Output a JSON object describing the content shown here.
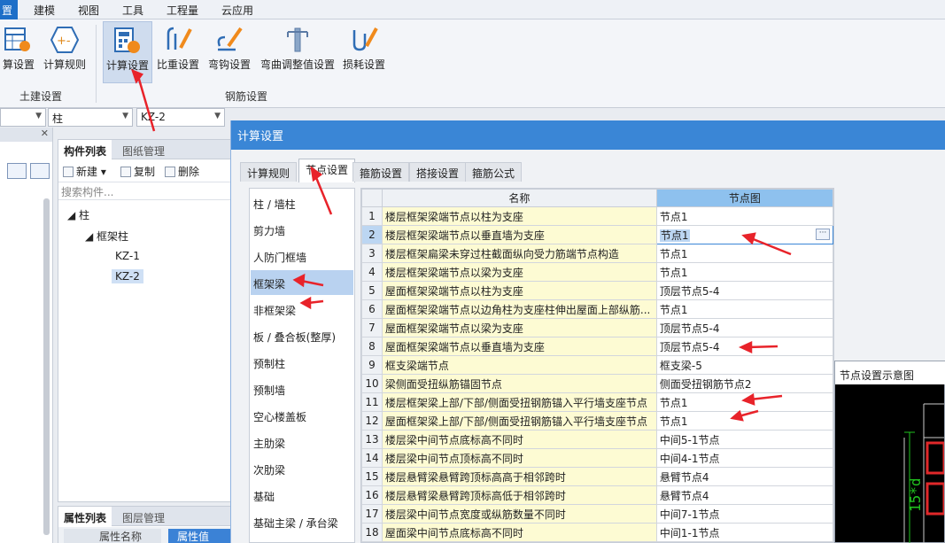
{
  "menu": [
    "置",
    "建模",
    "视图",
    "工具",
    "工程量",
    "云应用"
  ],
  "ribbon": {
    "buttons": [
      {
        "label": "算设置",
        "icon": "table-settings-icon"
      },
      {
        "label": "计算规则",
        "icon": "formula-plus-minus-icon"
      },
      {
        "label": "计算设置",
        "icon": "calculation-settings-icon",
        "selected": true
      },
      {
        "label": "比重设置",
        "icon": "rebar-weight-icon"
      },
      {
        "label": "弯钩设置",
        "icon": "hook-icon"
      },
      {
        "label": "弯曲调整值设置",
        "icon": "bend-adjust-icon"
      },
      {
        "label": "损耗设置",
        "icon": "loss-icon"
      }
    ],
    "groups": [
      "土建设置",
      "钢筋设置"
    ]
  },
  "combos": [
    "",
    "柱",
    "KZ-2"
  ],
  "component_panel": {
    "tabs": [
      "构件列表",
      "图纸管理"
    ],
    "toolbar": [
      "新建",
      "复制",
      "删除"
    ],
    "search_placeholder": "搜索构件...",
    "tree": [
      "柱",
      "框架柱",
      "KZ-1",
      "KZ-2"
    ]
  },
  "property_panel": {
    "tabs": [
      "属性列表",
      "图层管理"
    ],
    "col1": "属性名称",
    "col2": "属性值"
  },
  "dialog": {
    "title": "计算设置",
    "tabs": [
      "计算规则",
      "节点设置",
      "箍筋设置",
      "搭接设置",
      "箍筋公式"
    ],
    "categories": [
      "柱 / 墙柱",
      "剪力墙",
      "人防门框墙",
      "框架梁",
      "非框架梁",
      "板 / 叠合板(整厚)",
      "预制柱",
      "预制墙",
      "空心楼盖板",
      "主肋梁",
      "次肋梁",
      "基础",
      "基础主梁 / 承台梁"
    ],
    "columns": [
      "名称",
      "节点图"
    ],
    "rows": [
      {
        "n": "1",
        "name": "楼层框架梁端节点以柱为支座",
        "node": "节点1"
      },
      {
        "n": "2",
        "name": "楼层框架梁端节点以垂直墙为支座",
        "node": "节点1"
      },
      {
        "n": "3",
        "name": "楼层框架扁梁未穿过柱截面纵向受力筋端节点构造",
        "node": "节点1"
      },
      {
        "n": "4",
        "name": "楼层框架梁端节点以梁为支座",
        "node": "节点1"
      },
      {
        "n": "5",
        "name": "屋面框架梁端节点以柱为支座",
        "node": "顶层节点5-4"
      },
      {
        "n": "6",
        "name": "屋面框架梁端节点以边角柱为支座柱伸出屋面上部纵筋...",
        "node": "节点1"
      },
      {
        "n": "7",
        "name": "屋面框架梁端节点以梁为支座",
        "node": "顶层节点5-4"
      },
      {
        "n": "8",
        "name": "屋面框架梁端节点以垂直墙为支座",
        "node": "顶层节点5-4"
      },
      {
        "n": "9",
        "name": "框支梁端节点",
        "node": "框支梁-5"
      },
      {
        "n": "10",
        "name": "梁侧面受扭纵筋锚固节点",
        "node": "侧面受扭钢筋节点2"
      },
      {
        "n": "11",
        "name": "楼层框架梁上部/下部/侧面受扭钢筋锚入平行墙支座节点",
        "node": "节点1"
      },
      {
        "n": "12",
        "name": "屋面框架梁上部/下部/侧面受扭钢筋锚入平行墙支座节点",
        "node": "节点1"
      },
      {
        "n": "13",
        "name": "楼层梁中间节点底标高不同时",
        "node": "中间5-1节点"
      },
      {
        "n": "14",
        "name": "楼层梁中间节点顶标高不同时",
        "node": "中间4-1节点"
      },
      {
        "n": "15",
        "name": "楼层悬臂梁悬臂跨顶标高高于相邻跨时",
        "node": "悬臂节点4"
      },
      {
        "n": "16",
        "name": "楼层悬臂梁悬臂跨顶标高低于相邻跨时",
        "node": "悬臂节点4"
      },
      {
        "n": "17",
        "name": "楼层梁中间节点宽度或纵筋数量不同时",
        "node": "中间7-1节点"
      },
      {
        "n": "18",
        "name": "屋面梁中间节点底标高不同时",
        "node": "中间1-1节点"
      }
    ]
  },
  "preview": {
    "title": "节点设置示意图",
    "dim_label": "15*d",
    "colors": {
      "dim": "#21c21f",
      "rebar": "#e0282a"
    }
  },
  "accent_color": "#3a86d6",
  "annotation_color": "#e8232a"
}
